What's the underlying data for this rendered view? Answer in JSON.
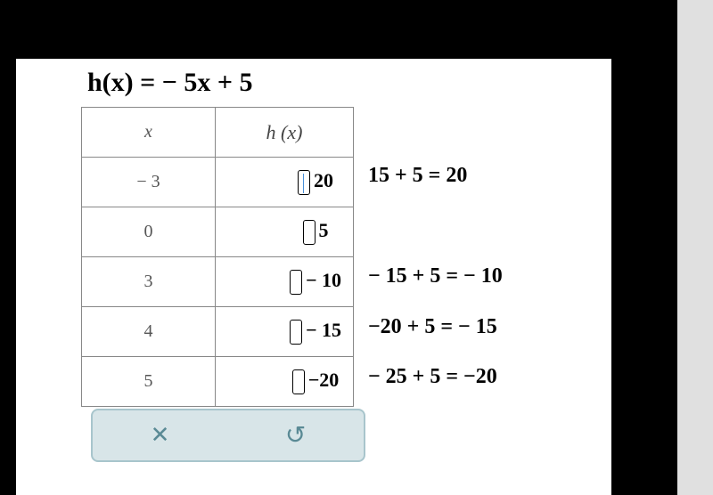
{
  "equation": "h(x) = − 5x + 5",
  "headers": {
    "x": "x",
    "hx": "h (x)"
  },
  "rows": [
    {
      "x": "− 3",
      "hx": "20",
      "calc": "15 + 5 = 20",
      "has_cursor": true
    },
    {
      "x": "0",
      "hx": "5",
      "calc": "",
      "has_cursor": false
    },
    {
      "x": "3",
      "hx": "− 10",
      "calc": "− 15 + 5 = − 10",
      "has_cursor": false
    },
    {
      "x": "4",
      "hx": "− 15",
      "calc": "−20 + 5 = − 15",
      "has_cursor": false
    },
    {
      "x": "5",
      "hx": "−20",
      "calc": "− 25 + 5 = −20",
      "has_cursor": false
    }
  ],
  "buttons": {
    "clear": "✕",
    "reset": "↺"
  },
  "chart_data": {
    "type": "table",
    "title": "h(x) = -5x + 5",
    "columns": [
      "x",
      "h(x)"
    ],
    "rows": [
      [
        -3,
        20
      ],
      [
        0,
        5
      ],
      [
        3,
        -10
      ],
      [
        4,
        -15
      ],
      [
        5,
        -20
      ]
    ],
    "calculations": [
      "15 + 5 = 20",
      "",
      "-15 + 5 = -10",
      "-20 + 5 = -15",
      "-25 + 5 = -20"
    ]
  }
}
